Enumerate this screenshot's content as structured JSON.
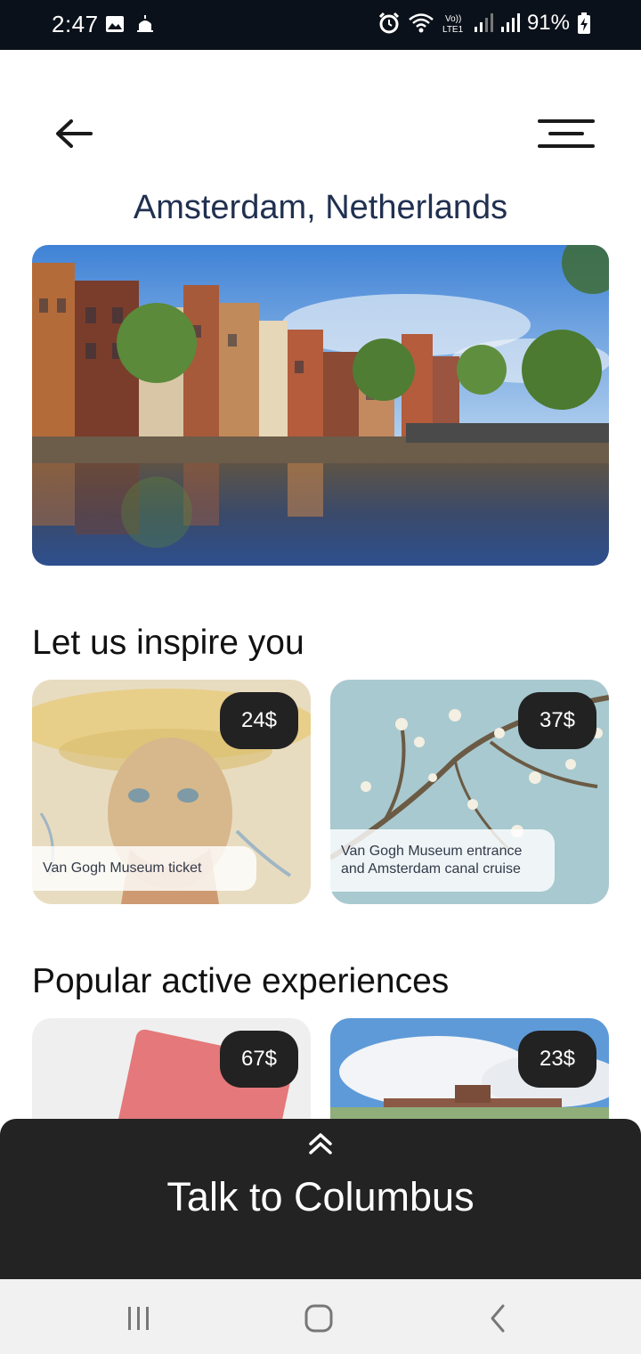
{
  "status_bar": {
    "time": "2:47",
    "battery": "91%",
    "left_icons": [
      "gallery-icon",
      "mosque-icon"
    ],
    "right_icons": [
      "alarm-icon",
      "wifi-icon",
      "volte-icon",
      "signal-icon",
      "signal-icon",
      "battery-charging-icon"
    ]
  },
  "header": {
    "back_icon": "arrow-left-icon",
    "menu_icon": "menu-icon"
  },
  "page": {
    "title": "Amsterdam, Netherlands"
  },
  "sections": [
    {
      "title": "Let us inspire you",
      "cards": [
        {
          "price": "24$",
          "caption": "Van Gogh Museum ticket"
        },
        {
          "price": "37$",
          "caption": "Van Gogh Museum entrance and Amsterdam canal cruise"
        }
      ]
    },
    {
      "title": "Popular active experiences",
      "cards": [
        {
          "price": "67$",
          "caption": ""
        },
        {
          "price": "23$",
          "caption": ""
        }
      ]
    }
  ],
  "bottom_sheet": {
    "label": "Talk to Columbus",
    "icon": "double-chevron-up-icon"
  },
  "nav_bar": {
    "icons": [
      "recents-icon",
      "home-icon",
      "back-icon"
    ]
  },
  "colors": {
    "title": "#203050",
    "price_badge": "#222222",
    "sheet": "#232323",
    "status_bar": "#0b111a"
  }
}
